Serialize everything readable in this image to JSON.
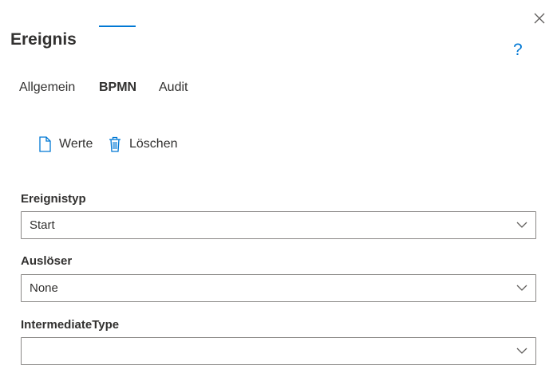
{
  "dialog": {
    "title": "Ereignis",
    "help_label": "?"
  },
  "tabs": [
    {
      "label": "Allgemein",
      "active": false
    },
    {
      "label": "BPMN",
      "active": true
    },
    {
      "label": "Audit",
      "active": false
    }
  ],
  "toolbar": {
    "values_label": "Werte",
    "delete_label": "Löschen"
  },
  "fields": [
    {
      "label": "Ereignistyp",
      "value": "Start"
    },
    {
      "label": "Auslöser",
      "value": "None"
    },
    {
      "label": "IntermediateType",
      "value": ""
    }
  ],
  "colors": {
    "accent": "#0078d4",
    "text": "#323130",
    "border": "#8a8886"
  }
}
